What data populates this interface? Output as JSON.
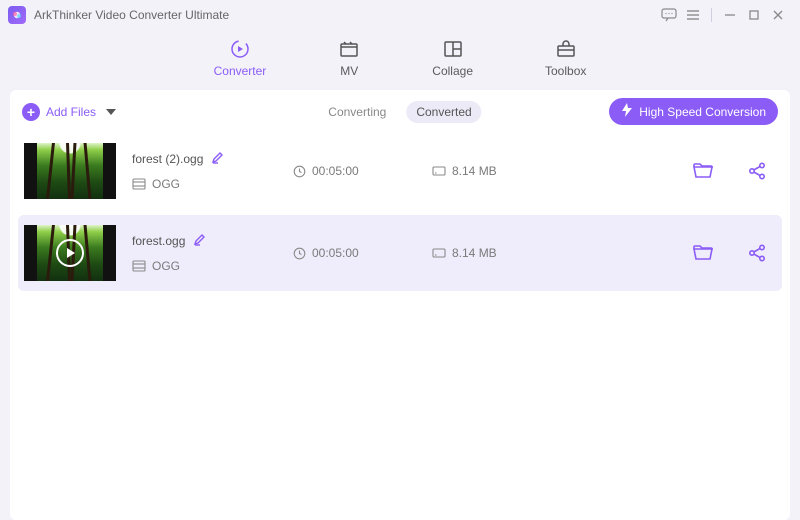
{
  "app_title": "ArkThinker Video Converter Ultimate",
  "tabs": {
    "converter": "Converter",
    "mv": "MV",
    "collage": "Collage",
    "toolbox": "Toolbox"
  },
  "toolbar": {
    "add_files": "Add Files",
    "converting": "Converting",
    "converted": "Converted",
    "high_speed": "High Speed Conversion"
  },
  "items": [
    {
      "filename": "forest (2).ogg",
      "format": "OGG",
      "duration": "00:05:00",
      "size": "8.14 MB"
    },
    {
      "filename": "forest.ogg",
      "format": "OGG",
      "duration": "00:05:00",
      "size": "8.14 MB"
    }
  ]
}
